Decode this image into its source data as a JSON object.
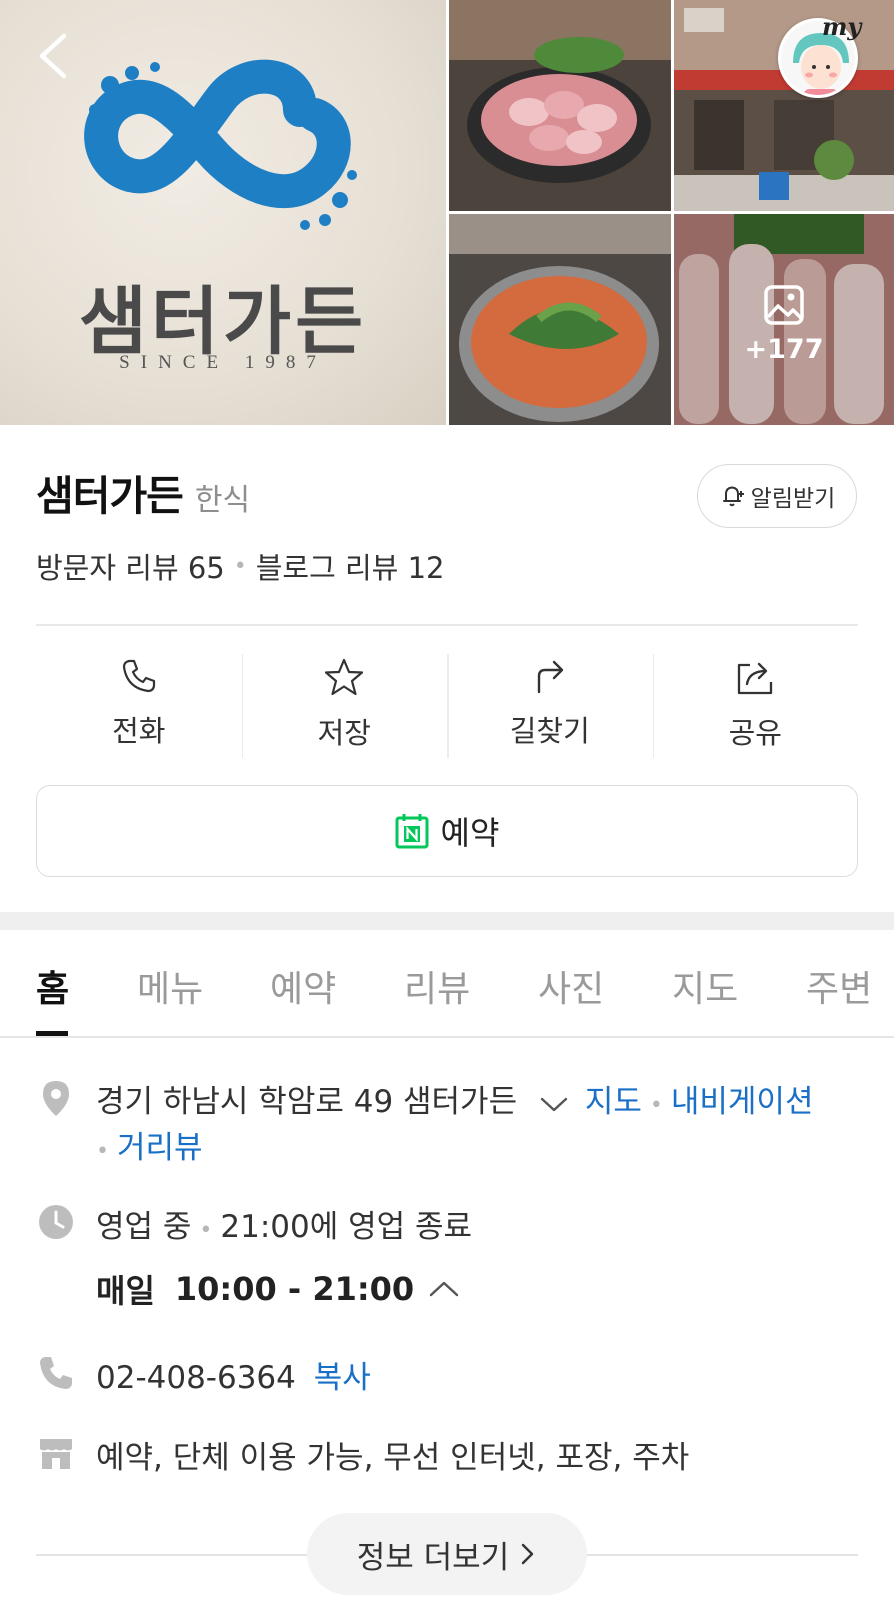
{
  "header": {
    "logo_brand_text": "샘터가든",
    "logo_since_text": "SINCE 1987",
    "my_badge": "my",
    "more_photos": "+177"
  },
  "place": {
    "name": "샘터가든",
    "category": "한식",
    "alarm_label": "알림받기",
    "visitor_review_label": "방문자 리뷰 65",
    "blog_review_label": "블로그 리뷰 12"
  },
  "actions": [
    {
      "label": "전화",
      "icon": "phone-icon"
    },
    {
      "label": "저장",
      "icon": "star-icon"
    },
    {
      "label": "길찾기",
      "icon": "directions-icon"
    },
    {
      "label": "공유",
      "icon": "share-icon"
    }
  ],
  "reserve": {
    "label": "예약"
  },
  "tabs": [
    "홈",
    "메뉴",
    "예약",
    "리뷰",
    "사진",
    "지도",
    "주변"
  ],
  "info": {
    "address": "경기 하남시 학암로 49 샘터가든",
    "map_link": "지도",
    "navigation_link": "내비게이션",
    "streetview_link": "거리뷰",
    "status": "영업 중",
    "close_time": "21:00에 영업 종료",
    "hours_day": "매일",
    "hours_time": "10:00 - 21:00",
    "phone": "02-408-6364",
    "copy_link": "복사",
    "amenities": "예약, 단체 이용 가능, 무선 인터넷, 포장, 주차"
  },
  "more_info": {
    "label": "정보 더보기"
  },
  "colors": {
    "link": "#1a6fc6",
    "naver_green": "#03c75a",
    "logo_blue": "#1f7fc4"
  }
}
